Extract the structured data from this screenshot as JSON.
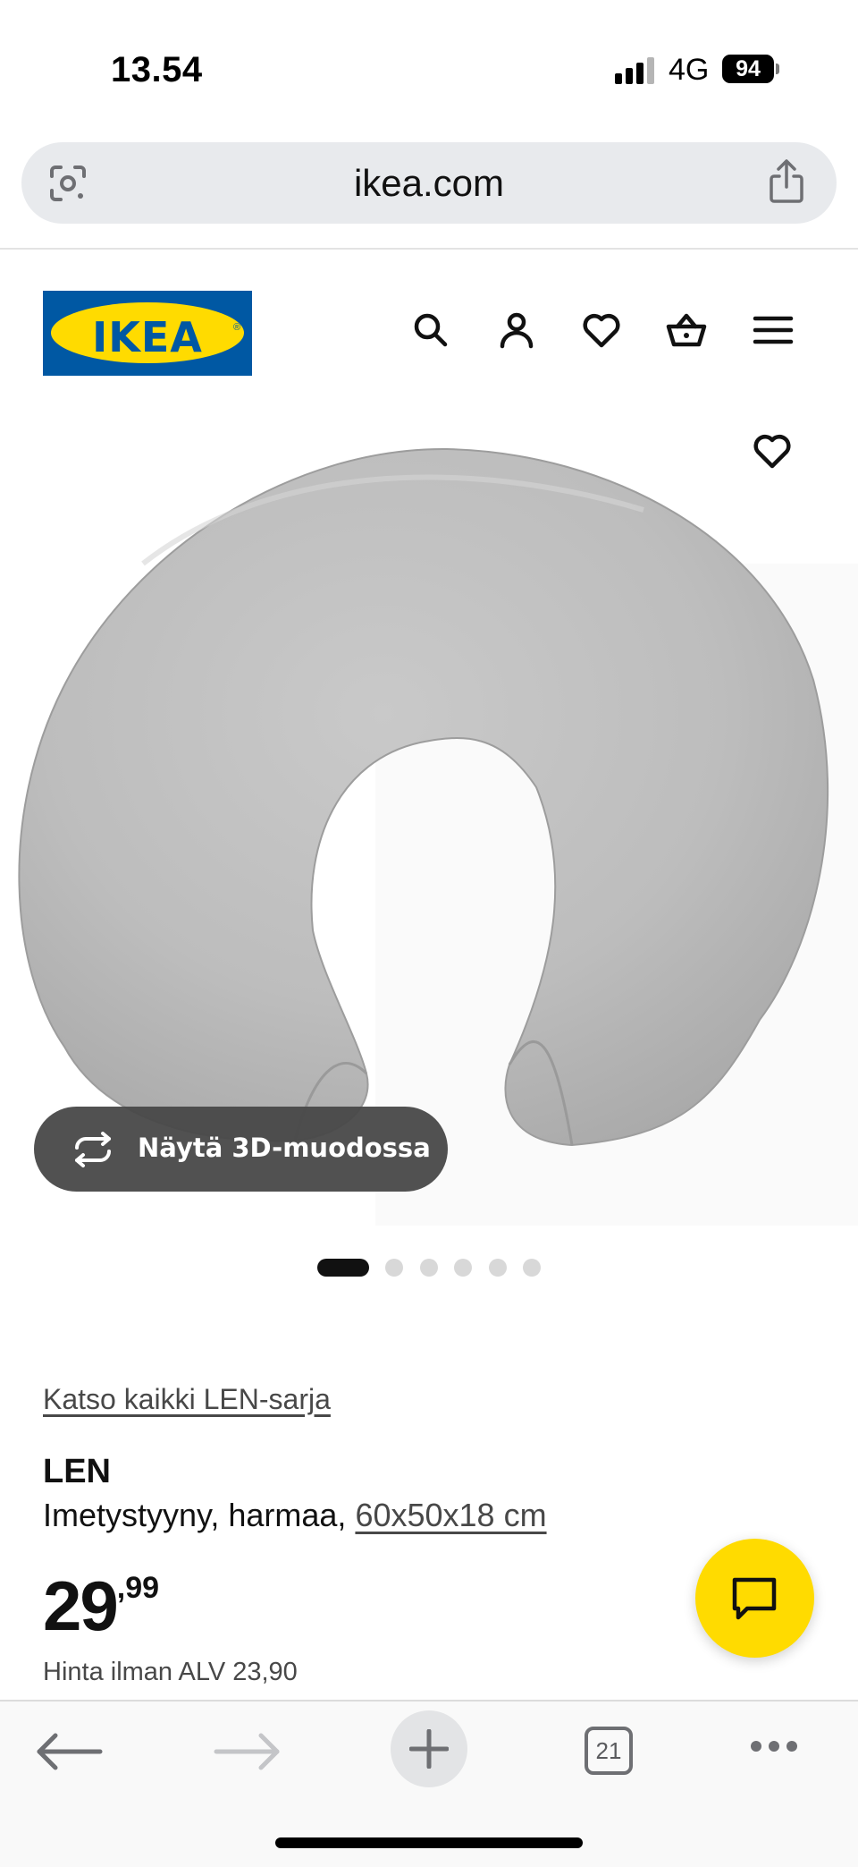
{
  "status_bar": {
    "time": "13.54",
    "network": "4G",
    "battery": "94"
  },
  "browser": {
    "url": "ikea.com",
    "tab_count": "21",
    "icons": [
      "lens-icon",
      "share-icon",
      "back-arrow-icon",
      "forward-arrow-icon",
      "new-tab-plus-icon",
      "tabs-icon",
      "more-dots-icon"
    ]
  },
  "header": {
    "logo_text": "IKEA",
    "icons": [
      "search-icon",
      "account-icon",
      "favorites-heart-icon",
      "cart-basket-icon",
      "menu-hamburger-icon"
    ],
    "brand_colors": {
      "blue": "#0058a3",
      "yellow": "#ffdb00"
    }
  },
  "gallery": {
    "view_3d_label": "Näytä 3D-muodossa",
    "image_count": 6,
    "active_index": 0
  },
  "product": {
    "series_link": "Katso kaikki LEN-sarja",
    "name": "LEN",
    "description_prefix": "Imetystyyny, harmaa, ",
    "size": "60x50x18 cm",
    "price_integer": "29",
    "price_decimals": ",99",
    "price_without_vat": "Hinta ilman ALV 23,90"
  },
  "chat": {
    "icon": "chat-bubble-icon",
    "color": "#ffdb00"
  }
}
